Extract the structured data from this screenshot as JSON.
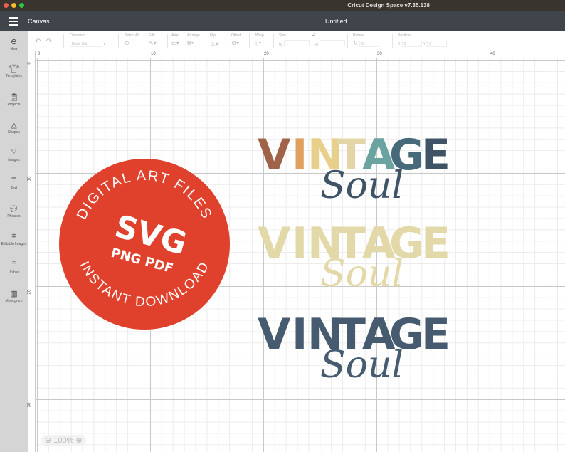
{
  "window": {
    "app_title": "Cricut Design Space  v7.35.138"
  },
  "header": {
    "section": "Canvas",
    "document_title": "Untitled"
  },
  "sidebar": {
    "items": [
      {
        "label": "New",
        "icon": "plus-circle-icon"
      },
      {
        "label": "Templates",
        "icon": "shirt-icon"
      },
      {
        "label": "Projects",
        "icon": "clipboard-icon"
      },
      {
        "label": "Shapes",
        "icon": "shapes-icon"
      },
      {
        "label": "Images",
        "icon": "bulb-icon"
      },
      {
        "label": "Text",
        "icon": "text-icon"
      },
      {
        "label": "Phrases",
        "icon": "speech-icon"
      },
      {
        "label": "Editable Images",
        "icon": "editable-image-icon"
      },
      {
        "label": "Upload",
        "icon": "upload-icon"
      },
      {
        "label": "Monogram",
        "icon": "monogram-icon"
      }
    ]
  },
  "toolbar": {
    "operation_label": "Operation",
    "operation_value": "Basic Cut",
    "select_all": "Select All",
    "edit": "Edit",
    "align": "Align",
    "arrange": "Arrange",
    "flip": "Flip",
    "offset": "Offset",
    "warp": "Warp",
    "size": "Size",
    "w": "W",
    "h": "H",
    "rotate": "Rotate",
    "rotate_value": "0",
    "position": "Position",
    "x": "X",
    "y": "Y",
    "x_value": "0",
    "y_value": "0"
  },
  "rulers": {
    "top": [
      "0",
      "10",
      "20",
      "30",
      "40"
    ],
    "left": [
      "0",
      "10",
      "20",
      "30"
    ]
  },
  "artwork": {
    "badge_top": "DIGITAL ART FILES",
    "badge_bottom": "INSTANT DOWNLOAD",
    "badge_main": "SVG",
    "badge_sub": "PNG PDF",
    "badge_color": "#e0412d",
    "word1": "VINTAGE",
    "word2": "Soul",
    "colors_multi": [
      "#a0634a",
      "#e0a060",
      "#e8cf8a",
      "#e3d5a7",
      "#6ba3a0",
      "#466a7a",
      "#3e5366"
    ],
    "color_cream": "#e3d8a8",
    "color_navy": "#465a70"
  },
  "zoom": {
    "level": "100%"
  }
}
